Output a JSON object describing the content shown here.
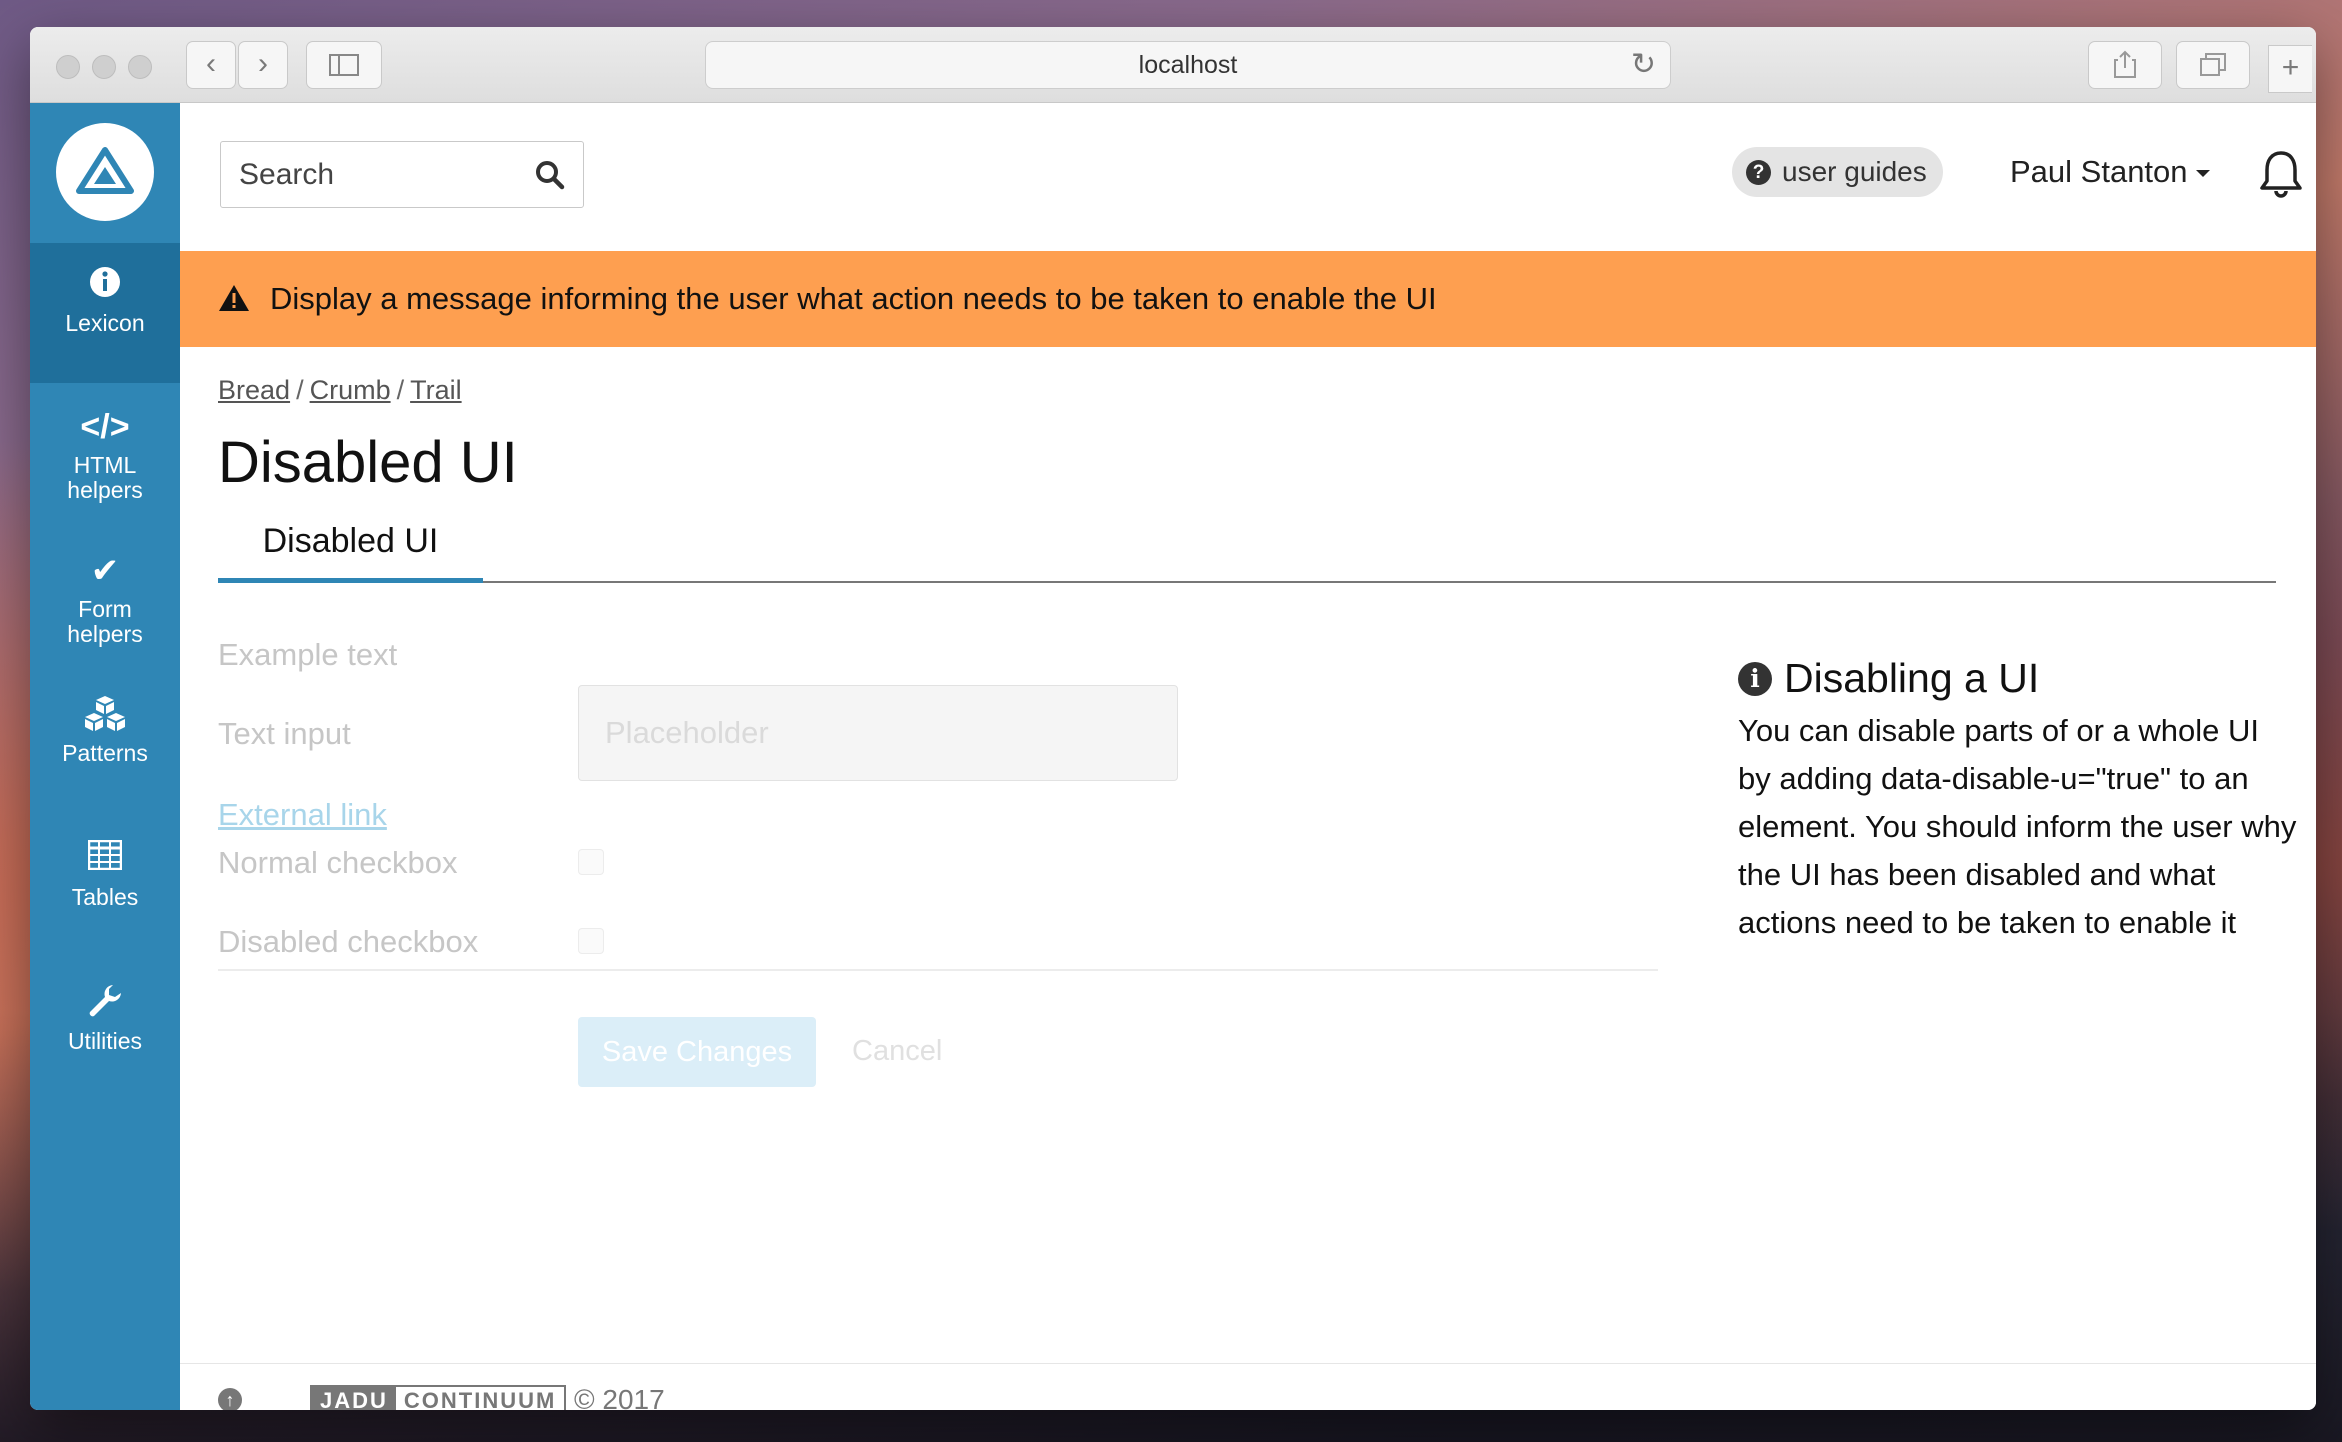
{
  "browser": {
    "address": "localhost"
  },
  "sidebar": {
    "items": [
      {
        "label": "Lexicon",
        "icon": "info-icon"
      },
      {
        "label": "HTML\nhelpers",
        "icon": "code-icon"
      },
      {
        "label": "Form\nhelpers",
        "icon": "check-icon"
      },
      {
        "label": "Patterns",
        "icon": "cubes-icon"
      },
      {
        "label": "Tables",
        "icon": "table-icon"
      },
      {
        "label": "Utilities",
        "icon": "wrench-icon"
      }
    ]
  },
  "header": {
    "search_placeholder": "Search",
    "user_guides": "user guides",
    "user_name": "Paul Stanton"
  },
  "alert": {
    "message": "Display a message informing the user what action needs to be taken to enable the UI"
  },
  "breadcrumb": [
    "Bread",
    "Crumb",
    "Trail"
  ],
  "page": {
    "title": "Disabled UI",
    "tab": "Disabled UI"
  },
  "form": {
    "example_text": "Example text",
    "text_input_label": "Text input",
    "text_input_placeholder": "Placeholder",
    "external_link": "External link",
    "normal_checkbox": "Normal checkbox",
    "disabled_checkbox": "Disabled checkbox",
    "save_button": "Save Changes",
    "cancel": "Cancel"
  },
  "info": {
    "heading": "Disabling a UI",
    "body": "You can disable parts of or a whole UI by adding data-disable-u=\"true\" to an element. You should inform the user why the UI has been disabled and what actions need to be taken to enable it"
  },
  "footer": {
    "brand_left": "JADU",
    "brand_right": "CONTINUUM",
    "copyright": "© 2017"
  },
  "colors": {
    "sidebar": "#2f86b5",
    "sidebar_active": "#1f6f9b",
    "alert": "#fe9f50"
  }
}
